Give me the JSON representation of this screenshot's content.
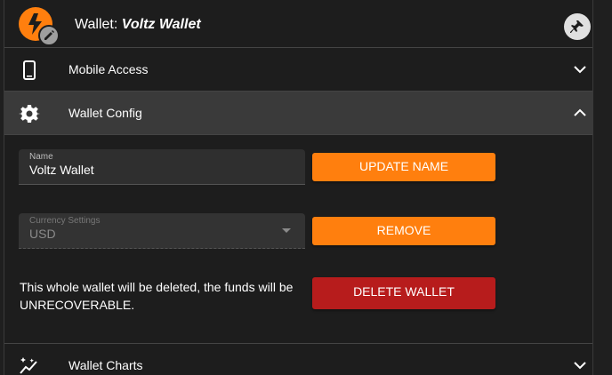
{
  "header": {
    "title_prefix": "Wallet:",
    "wallet_name": "Voltz Wallet",
    "avatar_icon": "lightning-bolt-icon",
    "edit_icon": "pencil-icon",
    "pin_icon": "pin-icon"
  },
  "sections": {
    "mobile_access": {
      "label": "Mobile Access",
      "icon": "smartphone-icon",
      "state": "collapsed"
    },
    "wallet_config": {
      "label": "Wallet Config",
      "icon": "gear-icon",
      "state": "expanded"
    },
    "wallet_charts": {
      "label": "Wallet Charts",
      "icon": "chart-sparkle-icon",
      "state": "collapsed"
    }
  },
  "config": {
    "name_label": "Name",
    "name_value": "Voltz Wallet",
    "update_name_button": "UPDATE NAME",
    "currency_label": "Currency Settings",
    "currency_value": "USD",
    "remove_button": "REMOVE",
    "warning_text": "This whole wallet will be deleted, the funds will be UNRECOVERABLE.",
    "delete_button": "DELETE WALLET"
  },
  "colors": {
    "accent": "#ff7f0e",
    "danger": "#b71c1c",
    "background": "#1d1d1d",
    "expanded_row": "#3a3a3a"
  }
}
